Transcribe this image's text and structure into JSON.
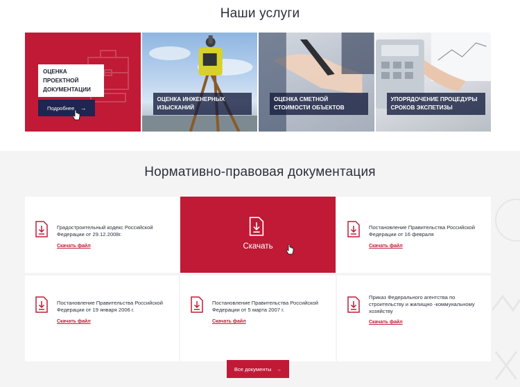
{
  "services": {
    "title": "Наши услуги",
    "cards": [
      {
        "label": "Оценка проектной документации",
        "button": "Подробнее",
        "icon": "briefcase-icon"
      },
      {
        "label": "Оценка инженерных изысканий",
        "icon": "theodolite-photo"
      },
      {
        "label": "Оценка сметной стоимости объектов",
        "icon": "handshake-photo"
      },
      {
        "label": "Упорядочение процедуры сроков экспетизы",
        "icon": "calculator-photo"
      }
    ]
  },
  "docs": {
    "title": "Нормативно-правовая документация",
    "download_label": "Скачать файл",
    "active_download": "Скачать",
    "items": [
      {
        "title": "Градостроительный кодекс Российской Федерации от 29.12.2008г."
      },
      {
        "title": "Постановление Правительства Российской Федерации от 16 февраля"
      },
      {
        "title": "Постановление Правительства Российской Федерации от 19 января 2006 г."
      },
      {
        "title": "Постановление Правительства Российской Федерации от 5 марта 2007 г."
      },
      {
        "title": "Приказ Федерального агентства по строительству и жилищно -коммунальному хозяйству"
      }
    ],
    "all_button": "Все документы"
  },
  "colors": {
    "accent": "#c01a36",
    "navy": "#1e2550",
    "bg_gray": "#f4f4f5"
  }
}
